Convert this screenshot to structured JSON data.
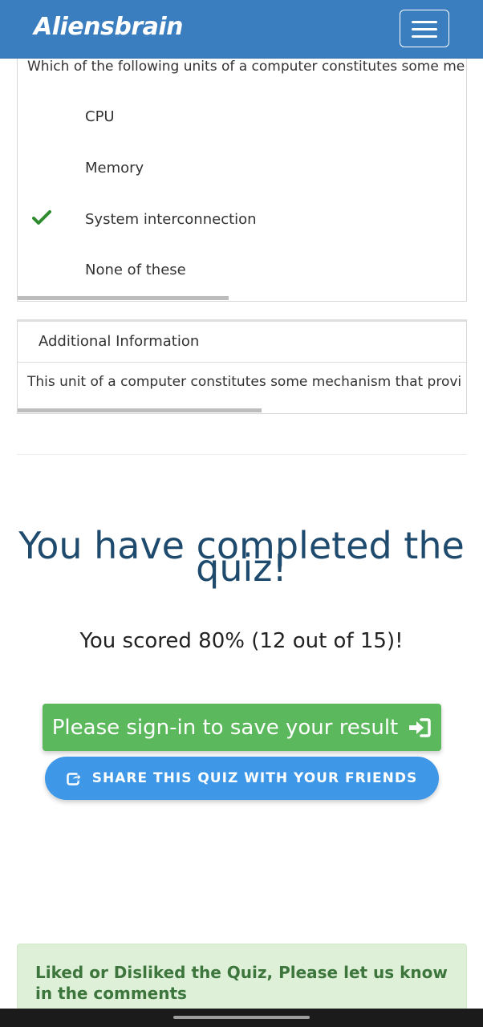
{
  "navbar": {
    "brand": "Aliensbrain",
    "menu_icon": "hamburger-menu-icon",
    "color": "#3a7ebf"
  },
  "question": {
    "text": "Which of the following units of a computer constitutes some me",
    "options": [
      {
        "label": "CPU",
        "correct": false
      },
      {
        "label": "Memory",
        "correct": false
      },
      {
        "label": "System interconnection",
        "correct": true
      },
      {
        "label": "None of these",
        "correct": false
      }
    ],
    "check_icon": "checkmark-icon",
    "check_color": "#2e8b2e"
  },
  "additional_info": {
    "heading": "Additional Information",
    "text": "This unit of a computer constitutes some mechanism that provi"
  },
  "result": {
    "completed_line1": "You have completed the",
    "completed_line2": "quiz!",
    "score_text": "You scored 80% (12 out of 15)!",
    "title_color": "#1e4a6e"
  },
  "actions": {
    "signin_label": "Please sign-in to save your result",
    "signin_icon": "sign-in-icon",
    "signin_color": "#5cb85c",
    "share_label": "SHARE THIS QUIZ WITH YOUR FRIENDS",
    "share_icon": "share-icon",
    "share_color": "#3f97e8"
  },
  "feedback": {
    "text": "Liked or Disliked the Quiz, Please let us know in the comments",
    "color": "#3c763d"
  }
}
